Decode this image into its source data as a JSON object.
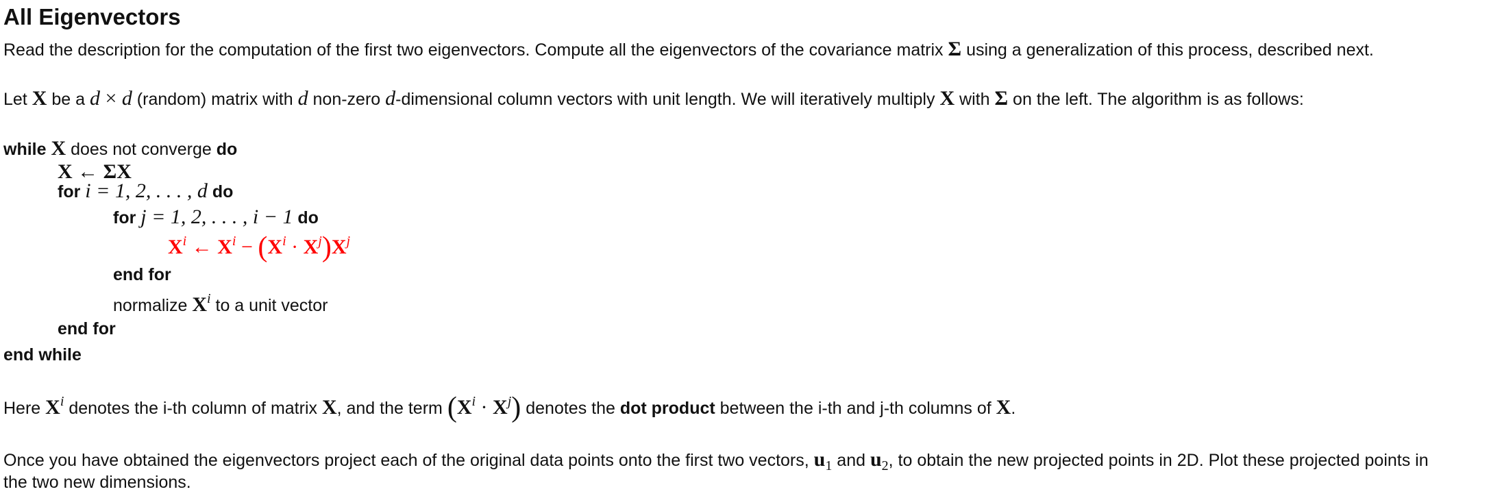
{
  "title": "All Eigenvectors",
  "intro": {
    "t1": "Read the description for the computation of the first two eigenvectors. Compute all the eigenvectors of the covariance matrix ",
    "sigma": "Σ",
    "t2": " using a generalization of this process, described next."
  },
  "p2": {
    "t1": "Let ",
    "X": "X",
    "t2": " be a ",
    "d1": "d",
    "times": " × ",
    "d2": "d",
    "t3": " (random) matrix with ",
    "d3": "d",
    "t4": " non-zero ",
    "d4": "d",
    "t5": "-dimensional column vectors with unit length. We will iteratively multiply ",
    "X2": "X",
    "t6": " with ",
    "sigma": "Σ",
    "t7": " on the left. The algorithm is as follows:"
  },
  "algo": {
    "while_kw": "while",
    "while_X": "X",
    "while_text": " does not converge ",
    "do_kw": "do",
    "assign": "X ← ΣX",
    "for_kw": "for",
    "for_i_range": "i = 1, 2, . . . , d",
    "for_do": "do",
    "for2_kw": "for",
    "for_j_range": "j = 1, 2, . . . , i − 1",
    "for2_do": "do",
    "update": {
      "lhs": "X",
      "lhs_sup": "i",
      "arrow": " ← ",
      "x1": "X",
      "x1_sup": "i",
      "minus": " − ",
      "lparen": "(",
      "x2": "X",
      "x2_sup": "i",
      "dot": " · ",
      "x3": "X",
      "x3_sup": "j",
      "rparen": ")",
      "x4": "X",
      "x4_sup": "j"
    },
    "end_for_inner": "end for",
    "normalize_t1": "normalize ",
    "normalize_X": "X",
    "normalize_sup": "i",
    "normalize_t2": " to a unit vector",
    "end_for_outer": "end for",
    "end_while": "end while"
  },
  "p3": {
    "t1": "Here ",
    "X": "X",
    "sup": "i",
    "t2": " denotes the i-th column of matrix ",
    "X2": "X",
    "t3": ", and the term ",
    "lparen": "(",
    "x3": "X",
    "x3_sup": "i",
    "dot": " · ",
    "x4": "X",
    "x4_sup": "j",
    "rparen": ")",
    "t4": " denotes the ",
    "bold": "dot product",
    "t5": " between the i-th and j-th columns of ",
    "X3": "X",
    "t6": "."
  },
  "p4": {
    "t1": "Once you have obtained the eigenvectors project each of the original data points onto the first two vectors, ",
    "u1": "u",
    "u1_sub": "1",
    "t2": " and ",
    "u2": "u",
    "u2_sub": "2",
    "t3": ", to obtain the new projected points in 2D. Plot these projected points in",
    "line2": "the two new dimensions."
  }
}
